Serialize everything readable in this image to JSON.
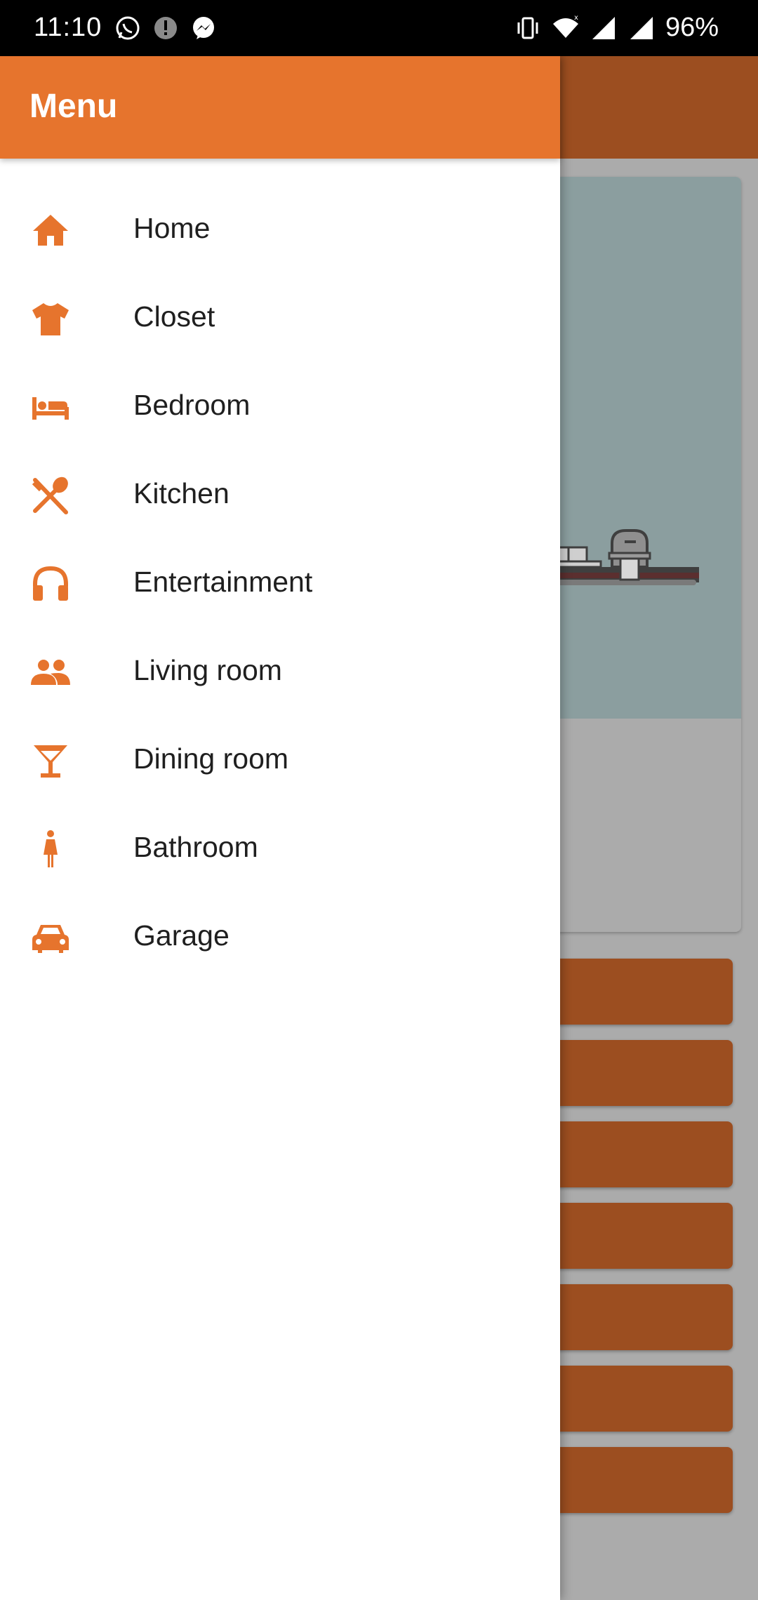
{
  "status_bar": {
    "time": "11:10",
    "battery": "96%",
    "icons": [
      "whatsapp-icon",
      "alert-icon",
      "messenger-icon",
      "vibrate-icon",
      "wifi-icon",
      "signal-icon",
      "signal-icon"
    ]
  },
  "drawer": {
    "title": "Menu",
    "items": [
      {
        "label": "Home",
        "icon": "home-icon"
      },
      {
        "label": "Closet",
        "icon": "tshirt-icon"
      },
      {
        "label": "Bedroom",
        "icon": "bed-icon"
      },
      {
        "label": "Kitchen",
        "icon": "utensils-icon"
      },
      {
        "label": "Entertainment",
        "icon": "headphones-icon"
      },
      {
        "label": "Living room",
        "icon": "people-icon"
      },
      {
        "label": "Dining room",
        "icon": "cocktail-icon"
      },
      {
        "label": "Bathroom",
        "icon": "woman-icon"
      },
      {
        "label": "Garage",
        "icon": "car-icon"
      }
    ]
  },
  "colors": {
    "accent": "#e6742d",
    "accent_dimmed": "#9c4e20",
    "scrim": "#ababab"
  }
}
